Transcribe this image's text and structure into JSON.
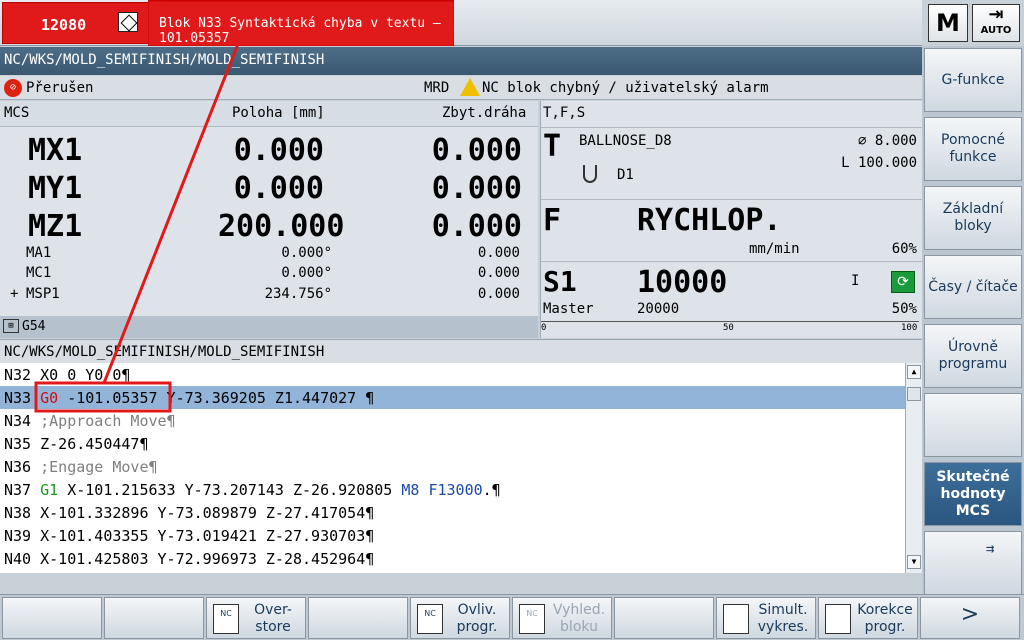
{
  "alarm": {
    "number": "12080",
    "text": "Blok N33 Syntaktická chyba v textu – 101.05357"
  },
  "mode": {
    "m_label": "M",
    "auto_label": "AUTO"
  },
  "path_top": "NC/WKS/MOLD_SEMIFINISH/MOLD_SEMIFINISH",
  "status": {
    "state": "Přerušen",
    "mrd": "MRD",
    "message": "NC blok chybný / uživatelský alarm"
  },
  "mcs": {
    "title": "MCS",
    "col_pos": "Poloha [mm]",
    "col_rest": "Zbyt.dráha",
    "axes": [
      {
        "name": "MX1",
        "pos": "0.000",
        "rest": "0.000"
      },
      {
        "name": "MY1",
        "pos": "0.000",
        "rest": "0.000"
      },
      {
        "name": "MZ1",
        "pos": "200.000",
        "rest": "0.000"
      }
    ],
    "small_axes": [
      {
        "prefix": "",
        "name": "MA1",
        "pos": "0.000°",
        "rest": "0.000"
      },
      {
        "prefix": "",
        "name": "MC1",
        "pos": "0.000°",
        "rest": "0.000"
      },
      {
        "prefix": "+",
        "name": "MSP1",
        "pos": "234.756°",
        "rest": "0.000"
      }
    ],
    "frame": "G54"
  },
  "tfs": {
    "title": "T,F,S",
    "t_label": "T",
    "tool": "BALLNOSE_D8",
    "diameter": "⌀ 8.000",
    "length": "L 100.000",
    "d_label": "D1",
    "f_label": "F",
    "feed": "RYCHLOP.",
    "feed_unit": "mm/min",
    "feed_override": "60%",
    "s_label": "S1",
    "speed": "10000",
    "spindle_dir": "I",
    "master_label": "Master",
    "master_value": "20000",
    "spindle_override": "50%",
    "scale_0": "0",
    "scale_50": "50",
    "scale_100": "100"
  },
  "path_prog": "NC/WKS/MOLD_SEMIFINISH/MOLD_SEMIFINISH",
  "program": [
    {
      "n": "N32",
      "parts": [
        [
          "X0 0 Y0 0¶",
          "#000"
        ]
      ]
    },
    {
      "n": "N33",
      "sel": true,
      "parts": [
        [
          "G0",
          "#d01010"
        ],
        [
          " -101.05357",
          "#000"
        ],
        [
          " Y-73.369205 Z1.447027 ¶",
          "#000"
        ]
      ]
    },
    {
      "n": "N34",
      "parts": [
        [
          ";Approach Move¶",
          "#808080"
        ]
      ]
    },
    {
      "n": "N35",
      "parts": [
        [
          "Z-26.450447¶",
          "#000"
        ]
      ]
    },
    {
      "n": "N36",
      "parts": [
        [
          ";Engage Move¶",
          "#808080"
        ]
      ]
    },
    {
      "n": "N37",
      "parts": [
        [
          "G1",
          "#1a9a1a"
        ],
        [
          " X-101.215633 Y-73.207143 Z-26.920805 ",
          "#000"
        ],
        [
          "M8 F13000",
          "#1a4aa8"
        ],
        [
          ".¶",
          "#000"
        ]
      ]
    },
    {
      "n": "N38",
      "parts": [
        [
          "X-101.332896 Y-73.089879 Z-27.417054¶",
          "#000"
        ]
      ]
    },
    {
      "n": "N39",
      "parts": [
        [
          "X-101.403355 Y-73.019421 Z-27.930703¶",
          "#000"
        ]
      ]
    },
    {
      "n": "N40",
      "parts": [
        [
          "X-101.425803 Y-72.996973 Z-28.452964¶",
          "#000"
        ]
      ]
    }
  ],
  "softkeys": [
    {
      "label": "G-funkce",
      "active": false
    },
    {
      "label": "Pomocné funkce",
      "active": false
    },
    {
      "label": "Základní bloky",
      "active": false
    },
    {
      "label": "Časy / čítače",
      "active": false
    },
    {
      "label": "Úrovně programu",
      "active": false
    },
    {
      "label": "",
      "active": false
    },
    {
      "label": "Skutečné hodnoty MCS",
      "active": true
    },
    {
      "label": "",
      "active": false
    }
  ],
  "bottom_keys": [
    {
      "label": "",
      "icon": ""
    },
    {
      "label": "",
      "icon": ""
    },
    {
      "label": "Over-store",
      "icon": "NC"
    },
    {
      "label": "",
      "icon": ""
    },
    {
      "label": "Ovliv. progr.",
      "icon": "NC"
    },
    {
      "label": "Vyhled. bloku",
      "icon": "NC",
      "disabled": true
    },
    {
      "label": "",
      "icon": ""
    },
    {
      "label": "Simult. vykres.",
      "icon": ""
    },
    {
      "label": "Korekce progr.",
      "icon": ""
    },
    {
      "label": ">",
      "icon": ""
    }
  ]
}
